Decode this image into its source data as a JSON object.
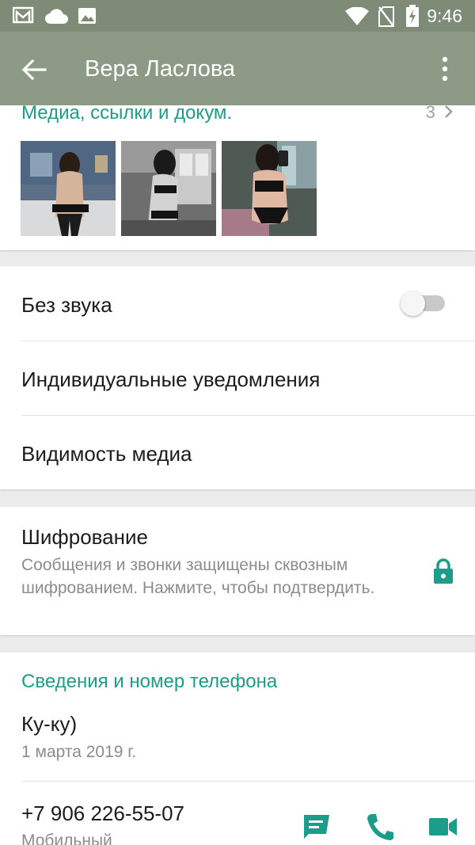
{
  "status_bar": {
    "time": "9:46",
    "icons": [
      "gmail-notification-icon",
      "cloud-icon",
      "image-icon",
      "wifi-icon",
      "no-sim-icon",
      "battery-charging-icon"
    ]
  },
  "app_bar": {
    "title": "Вера Ласлова",
    "back_icon": "arrow-back-icon",
    "menu_icon": "more-vert-icon"
  },
  "media_section": {
    "header": "Медиа, ссылки и докум.",
    "count": "3",
    "thumbnails": [
      "photo-1",
      "photo-2",
      "photo-3"
    ]
  },
  "settings": {
    "mute_label": "Без звука",
    "mute_enabled": false,
    "custom_notifications_label": "Индивидуальные уведомления",
    "media_visibility_label": "Видимость медиа"
  },
  "encryption": {
    "title": "Шифрование",
    "description": "Сообщения и звонки защищены сквозным шифрованием. Нажмите, чтобы подтвердить.",
    "icon": "lock-icon"
  },
  "info_section": {
    "header": "Сведения и номер телефона",
    "about": "Ку-ку)",
    "about_date": "1 марта 2019 г.",
    "phone": "+7 906 226-55-07",
    "phone_type": "Мобильный",
    "actions": [
      "message-icon",
      "call-icon",
      "video-call-icon"
    ]
  },
  "colors": {
    "accent": "#1d9d89",
    "app_bar": "#8d9a85",
    "status_bar": "#7d8b77"
  }
}
